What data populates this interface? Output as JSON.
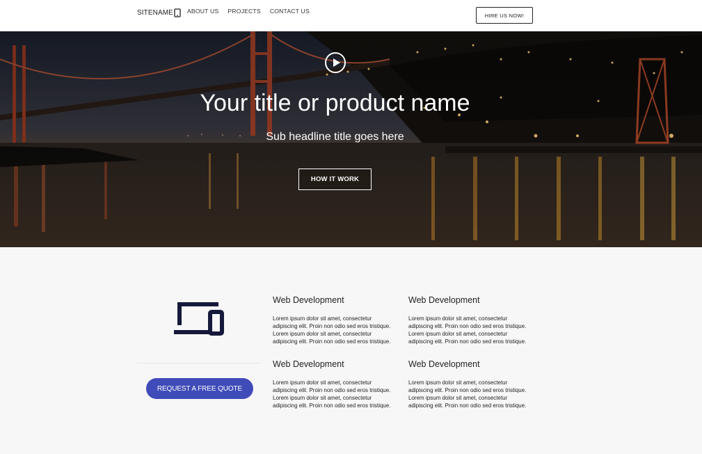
{
  "header": {
    "sitename": "SITENAME",
    "brand_icon": "tablet-icon",
    "nav": [
      "ABOUT US",
      "PROJECTS",
      "CONTACT US"
    ],
    "cta": "HIRE US NOW!"
  },
  "hero": {
    "play_icon": "play-icon",
    "title": "Your title or product name",
    "subtitle": "Sub headline title goes here",
    "button": "HOW IT WORK"
  },
  "features": {
    "icon": "devices-icon",
    "quote_button": "REQUEST A FREE QUOTE",
    "accent_color": "#3f4bb8",
    "cards": [
      {
        "title": "Web Development",
        "text": "Lorem ipsum dolor sit amet, consectetur adipiscing elit. Proin non odio sed eros tristique. Lorem ipsum dolor sit amet, consectetur adipiscing elit. Proin non odio sed eros tristique."
      },
      {
        "title": "Web Development",
        "text": "Lorem ipsum dolor sit amet, consectetur adipiscing elit. Proin non odio sed eros tristique. Lorem ipsum dolor sit amet, consectetur adipiscing elit. Proin non odio sed eros tristique."
      },
      {
        "title": "Web Development",
        "text": "Lorem ipsum dolor sit amet, consectetur adipiscing elit. Proin non odio sed eros tristique. Lorem ipsum dolor sit amet, consectetur adipiscing elit. Proin non odio sed eros tristique."
      },
      {
        "title": "Web Development",
        "text": "Lorem ipsum dolor sit amet, consectetur adipiscing elit. Proin non odio sed eros tristique. Lorem ipsum dolor sit amet, consectetur adipiscing elit. Proin non odio sed eros tristique."
      }
    ]
  }
}
